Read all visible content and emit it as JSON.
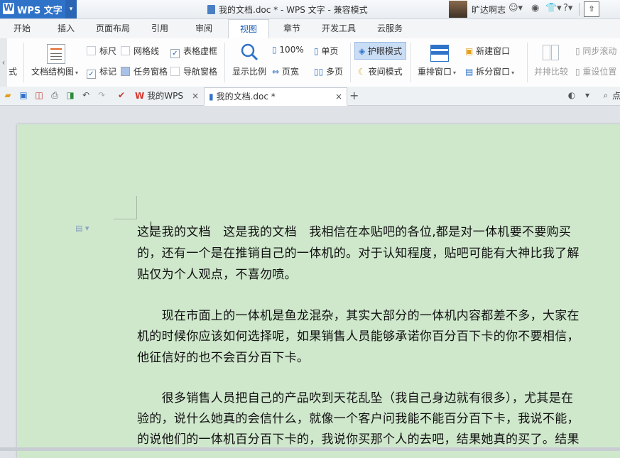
{
  "titlebar": {
    "app_logo": "W",
    "app_name": "WPS 文字",
    "app_dropdown": "▾",
    "document_title": "我的文档.doc * - WPS 文字 - 兼容模式",
    "user_name": "旷达啊志",
    "icons": [
      "user-level-icon",
      "shirt-icon",
      "help-icon",
      "window-icon"
    ]
  },
  "tabs": [
    "开始",
    "插入",
    "页面布局",
    "引用",
    "审阅",
    "视图",
    "章节",
    "开发工具",
    "云服务"
  ],
  "active_tab": "视图",
  "ribbon": {
    "scroll_left_label": "‹",
    "cut_label": "式",
    "doc_structure": "文档结构图",
    "ruler": "标尺",
    "gridlines": "网格线",
    "table_gridlines": "表格虚框",
    "marks": "标记",
    "task_pane": "任务窗格",
    "nav_pane": "导航窗格",
    "zoom": "显示比例",
    "zoom_100": "100%",
    "page_width": "页宽",
    "single_page": "单页",
    "multi_page": "多页",
    "eye_mode": "护眼模式",
    "night_mode": "夜间模式",
    "arrange": "重排窗口",
    "new_window": "新建窗口",
    "split_window": "拆分窗口",
    "side_by_side": "并排比较",
    "sync_scroll": "同步滚动",
    "reset_pos": "重设位置",
    "checked": {
      "ruler": false,
      "gridlines": false,
      "table_gridlines": true,
      "marks": true,
      "task_pane": false,
      "nav_pane": false
    }
  },
  "quickbar": {
    "tabs": [
      {
        "label": "我的WPS",
        "close": "×"
      },
      {
        "label": "我的文档.doc *",
        "close": "×"
      }
    ],
    "new_tab": "+",
    "search_label": "点"
  },
  "document": {
    "lines": [
      "这是我的文档　这是我的文档　我相信在本贴吧的各位,都是对一体机要不要购买",
      "的，还有一个是在推销自己的一体机的。对于认知程度，贴吧可能有大神比我了解",
      "贴仅为个人观点，不喜勿喷。",
      "",
      "　　现在市面上的一体机是鱼龙混杂，其实大部分的一体机内容都差不多，大家在",
      "机的时候你应该如何选择呢，如果销售人员能够承诺你百分百下卡的你不要相信，",
      "他征信好的也不会百分百下卡。",
      "",
      "　　很多销售人员把自己的产品吹到天花乱坠（我自己身边就有很多），尤其是在",
      "验的，说什么她真的会信什么，就像一个客户问我能不能百分百下卡，我说不能，",
      "的说他们的一体机百分百下卡的，我说你买那个人的去吧，结果她真的买了。结果"
    ]
  },
  "colors": {
    "page_bg": "#cfe8cc",
    "app_blue": "#2f73c9",
    "active_tab_text": "#1d5fb3"
  }
}
